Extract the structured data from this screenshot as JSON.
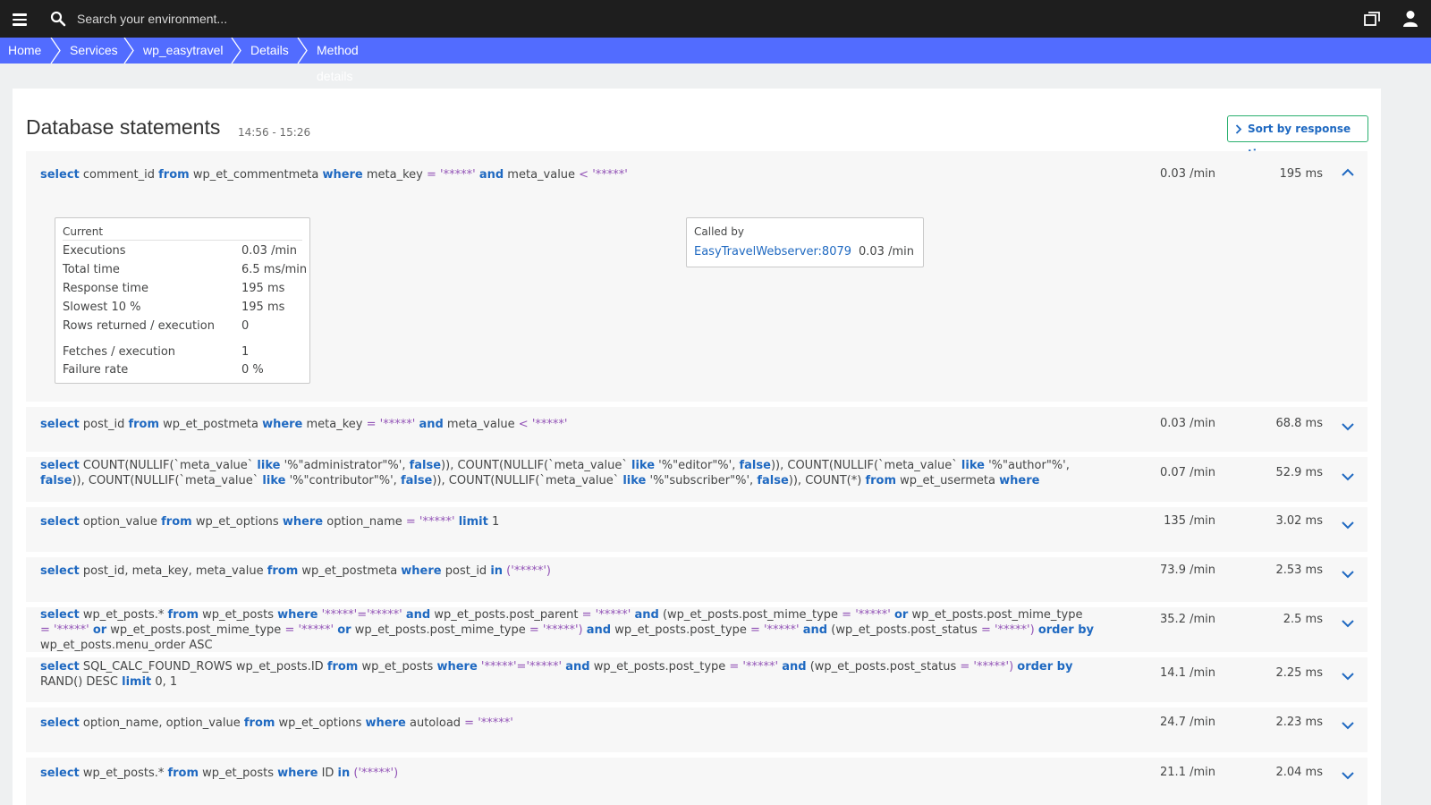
{
  "topbar": {
    "search_placeholder": "Search your environment..."
  },
  "breadcrumbs": [
    "Home",
    "Services",
    "wp_easytravel",
    "Details",
    "Method details"
  ],
  "section": {
    "title": "Database statements",
    "time_range": "14:56 - 15:26",
    "sort_label": "Sort by response time"
  },
  "expanded": {
    "current_caption": "Current",
    "metrics": [
      {
        "label": "Executions",
        "value": "0.03 /min"
      },
      {
        "label": "Total time",
        "value": "6.5 ms/min"
      },
      {
        "label": "Response time",
        "value": "195 ms"
      },
      {
        "label": "Slowest 10 %",
        "value": "195 ms"
      },
      {
        "label": "Rows returned / execution",
        "value": "0"
      },
      {
        "label": "Fetches / execution",
        "value": "1"
      },
      {
        "label": "Failure rate",
        "value": "0 %"
      }
    ],
    "called_by_caption": "Called by",
    "caller_name": "EasyTravelWebserver:8079",
    "caller_rate": "0.03 /min"
  },
  "statements": [
    {
      "frequency": "0.03 /min",
      "response": "195 ms"
    },
    {
      "frequency": "0.03 /min",
      "response": "68.8 ms"
    },
    {
      "frequency": "0.07 /min",
      "response": "52.9 ms"
    },
    {
      "frequency": "135 /min",
      "response": "3.02 ms"
    },
    {
      "frequency": "73.9 /min",
      "response": "2.53 ms"
    },
    {
      "frequency": "35.2 /min",
      "response": "2.5 ms"
    },
    {
      "frequency": "14.1 /min",
      "response": "2.25 ms"
    },
    {
      "frequency": "24.7 /min",
      "response": "2.23 ms"
    },
    {
      "frequency": "21.1 /min",
      "response": "2.04 ms"
    }
  ],
  "statement_text": [
    [
      {
        "t": "select",
        "k": "kw"
      },
      {
        "t": " comment_id "
      },
      {
        "t": "from",
        "k": "kw"
      },
      {
        "t": " wp_et_commentmeta "
      },
      {
        "t": "where",
        "k": "kw"
      },
      {
        "t": " meta_key "
      },
      {
        "t": "= '*****'",
        "k": "str"
      },
      {
        "t": " "
      },
      {
        "t": "and",
        "k": "kw"
      },
      {
        "t": " meta_value "
      },
      {
        "t": "< '*****'",
        "k": "str"
      }
    ],
    [
      {
        "t": "select",
        "k": "kw"
      },
      {
        "t": " post_id "
      },
      {
        "t": "from",
        "k": "kw"
      },
      {
        "t": " wp_et_postmeta "
      },
      {
        "t": "where",
        "k": "kw"
      },
      {
        "t": " meta_key "
      },
      {
        "t": "= '*****'",
        "k": "str"
      },
      {
        "t": " "
      },
      {
        "t": "and",
        "k": "kw"
      },
      {
        "t": " meta_value "
      },
      {
        "t": "< '*****'",
        "k": "str"
      }
    ],
    [
      {
        "t": "select",
        "k": "kw"
      },
      {
        "t": " COUNT(NULLIF(`meta_value` "
      },
      {
        "t": "like",
        "k": "kw"
      },
      {
        "t": " '%\"administrator\"%', "
      },
      {
        "t": "false",
        "k": "kw"
      },
      {
        "t": ")), COUNT(NULLIF(`meta_value` "
      },
      {
        "t": "like",
        "k": "kw"
      },
      {
        "t": " '%\"editor\"%', "
      },
      {
        "t": "false",
        "k": "kw"
      },
      {
        "t": ")), COUNT(NULLIF(`meta_value` "
      },
      {
        "t": "like",
        "k": "kw"
      },
      {
        "t": " '%\"author\"%', "
      },
      {
        "t": "false",
        "k": "kw"
      },
      {
        "t": ")), COUNT(NULLIF(`meta_value` "
      },
      {
        "t": "like",
        "k": "kw"
      },
      {
        "t": " '%\"contributor\"%', "
      },
      {
        "t": "false",
        "k": "kw"
      },
      {
        "t": ")), COUNT(NULLIF(`meta_value` "
      },
      {
        "t": "like",
        "k": "kw"
      },
      {
        "t": " '%\"subscriber\"%', "
      },
      {
        "t": "false",
        "k": "kw"
      },
      {
        "t": ")), COUNT(*) "
      },
      {
        "t": "from",
        "k": "kw"
      },
      {
        "t": " wp_et_usermeta "
      },
      {
        "t": "where",
        "k": "kw"
      },
      {
        "t": " meta_key "
      },
      {
        "t": "= '*****'",
        "k": "str"
      }
    ],
    [
      {
        "t": "select",
        "k": "kw"
      },
      {
        "t": " option_value "
      },
      {
        "t": "from",
        "k": "kw"
      },
      {
        "t": " wp_et_options "
      },
      {
        "t": "where",
        "k": "kw"
      },
      {
        "t": " option_name "
      },
      {
        "t": "= '*****'",
        "k": "str"
      },
      {
        "t": " "
      },
      {
        "t": "limit",
        "k": "kw"
      },
      {
        "t": " 1"
      }
    ],
    [
      {
        "t": "select",
        "k": "kw"
      },
      {
        "t": " post_id, meta_key, meta_value "
      },
      {
        "t": "from",
        "k": "kw"
      },
      {
        "t": " wp_et_postmeta "
      },
      {
        "t": "where",
        "k": "kw"
      },
      {
        "t": " post_id "
      },
      {
        "t": "in",
        "k": "kw"
      },
      {
        "t": " ('*****')",
        "k": "str"
      }
    ],
    [
      {
        "t": "select",
        "k": "kw"
      },
      {
        "t": " wp_et_posts.* "
      },
      {
        "t": "from",
        "k": "kw"
      },
      {
        "t": " wp_et_posts "
      },
      {
        "t": "where",
        "k": "kw"
      },
      {
        "t": " '*****'='*****' ",
        "k": "str"
      },
      {
        "t": "and",
        "k": "kw"
      },
      {
        "t": " wp_et_posts.post_parent "
      },
      {
        "t": "= '*****' ",
        "k": "str"
      },
      {
        "t": "and",
        "k": "kw"
      },
      {
        "t": " (wp_et_posts.post_mime_type "
      },
      {
        "t": "= '*****' ",
        "k": "str"
      },
      {
        "t": "or",
        "k": "kw"
      },
      {
        "t": " wp_et_posts.post_mime_type "
      },
      {
        "t": "= '*****' ",
        "k": "str"
      },
      {
        "t": "or",
        "k": "kw"
      },
      {
        "t": " wp_et_posts.post_mime_type "
      },
      {
        "t": "= '*****' ",
        "k": "str"
      },
      {
        "t": "or",
        "k": "kw"
      },
      {
        "t": " wp_et_posts.post_mime_type "
      },
      {
        "t": "= '*****') ",
        "k": "str"
      },
      {
        "t": "and",
        "k": "kw"
      },
      {
        "t": " wp_et_posts.post_type "
      },
      {
        "t": "= '*****' ",
        "k": "str"
      },
      {
        "t": "and",
        "k": "kw"
      },
      {
        "t": " (wp_et_posts.post_status "
      },
      {
        "t": "= '*****') ",
        "k": "str"
      },
      {
        "t": "order by",
        "k": "kw"
      },
      {
        "t": " wp_et_posts.menu_order ASC"
      }
    ],
    [
      {
        "t": "select",
        "k": "kw"
      },
      {
        "t": " SQL_CALC_FOUND_ROWS wp_et_posts.ID "
      },
      {
        "t": "from",
        "k": "kw"
      },
      {
        "t": " wp_et_posts "
      },
      {
        "t": "where",
        "k": "kw"
      },
      {
        "t": " '*****'='*****' ",
        "k": "str"
      },
      {
        "t": "and",
        "k": "kw"
      },
      {
        "t": " wp_et_posts.post_type "
      },
      {
        "t": "= '*****' ",
        "k": "str"
      },
      {
        "t": "and",
        "k": "kw"
      },
      {
        "t": " (wp_et_posts.post_status "
      },
      {
        "t": "= '*****') ",
        "k": "str"
      },
      {
        "t": "order by",
        "k": "kw"
      },
      {
        "t": " RAND() DESC "
      },
      {
        "t": "limit",
        "k": "kw"
      },
      {
        "t": " 0, 1"
      }
    ],
    [
      {
        "t": "select",
        "k": "kw"
      },
      {
        "t": " option_name, option_value "
      },
      {
        "t": "from",
        "k": "kw"
      },
      {
        "t": " wp_et_options "
      },
      {
        "t": "where",
        "k": "kw"
      },
      {
        "t": " autoload "
      },
      {
        "t": "= '*****'",
        "k": "str"
      }
    ],
    [
      {
        "t": "select",
        "k": "kw"
      },
      {
        "t": " wp_et_posts.* "
      },
      {
        "t": "from",
        "k": "kw"
      },
      {
        "t": " wp_et_posts "
      },
      {
        "t": "where",
        "k": "kw"
      },
      {
        "t": " ID "
      },
      {
        "t": "in",
        "k": "kw"
      },
      {
        "t": " ('*****')",
        "k": "str"
      }
    ]
  ],
  "colors": {
    "topbar": "#1e1e1e",
    "breadcrumb": "#526cff",
    "keyword": "#1f69c1",
    "string": "#9355b7",
    "sort_border": "#2ab06f"
  },
  "icons": [
    "menu-icon",
    "search-icon",
    "window-icon",
    "user-icon",
    "chevron-up-icon",
    "chevron-down-icon",
    "chevron-right-icon"
  ]
}
